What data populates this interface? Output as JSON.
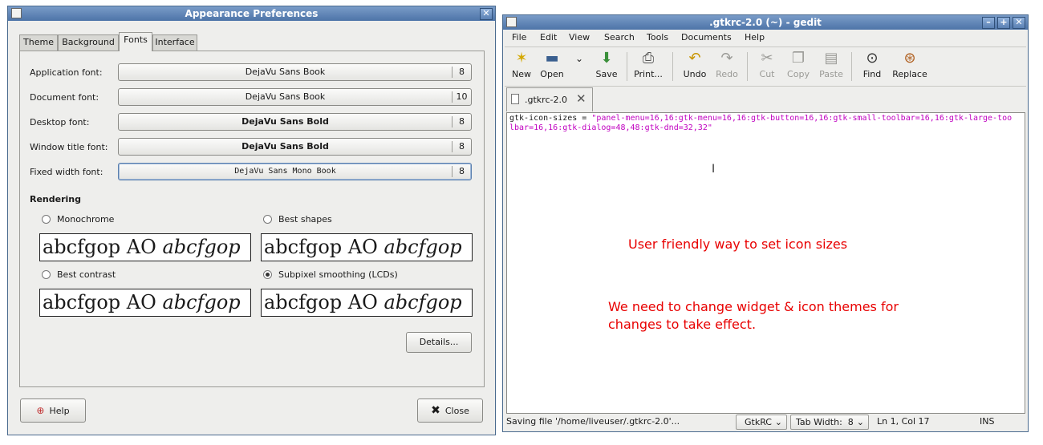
{
  "appearance": {
    "title": "Appearance Preferences",
    "tabs": [
      "Theme",
      "Background",
      "Fonts",
      "Interface"
    ],
    "active_tab": "Fonts",
    "fonts": [
      {
        "label": "Application font:",
        "font": "DejaVu Sans Book",
        "size": "8"
      },
      {
        "label": "Document font:",
        "font": "DejaVu Sans Book",
        "size": "10"
      },
      {
        "label": "Desktop font:",
        "font": "DejaVu Sans Bold",
        "size": "8"
      },
      {
        "label": "Window title font:",
        "font": "DejaVu Sans Bold",
        "size": "8"
      },
      {
        "label": "Fixed width font:",
        "font": "DejaVu Sans Mono Book",
        "size": "8"
      }
    ],
    "rendering_title": "Rendering",
    "rendering_options": [
      {
        "label": "Monochrome",
        "selected": false
      },
      {
        "label": "Best shapes",
        "selected": false
      },
      {
        "label": "Best contrast",
        "selected": false
      },
      {
        "label": "Subpixel smoothing (LCDs)",
        "selected": true
      }
    ],
    "preview_text": "abcfgop AO",
    "preview_italic": "abcfgop",
    "details_label": "Details...",
    "help_label": "Help",
    "close_label": "Close"
  },
  "gedit": {
    "title": ".gtkrc-2.0 (~) - gedit",
    "menu": [
      "File",
      "Edit",
      "View",
      "Search",
      "Tools",
      "Documents",
      "Help"
    ],
    "toolbar": [
      "New",
      "Open",
      "Save",
      "Print...",
      "Undo",
      "Redo",
      "Cut",
      "Copy",
      "Paste",
      "Find",
      "Replace"
    ],
    "tab_label": ".gtkrc-2.0",
    "code_key": "gtk-icon-sizes = ",
    "code_value": "\"panel-menu=16,16:gtk-menu=16,16:gtk-button=16,16:gtk-small-toolbar=16,16:gtk-large-toolbar=16,16:gtk-dialog=48,48:gtk-dnd=32,32\"",
    "note1": "User friendly way to set icon sizes",
    "note2_line1": "We need to change widget & icon themes for",
    "note2_line2": "changes to take effect.",
    "status_text": "Saving file '/home/liveuser/.gtkrc-2.0'...",
    "language": "GtkRC",
    "tab_width": "Tab Width:  8",
    "position": "Ln 1, Col 17",
    "mode": "INS",
    "note_color": "#e80000",
    "string_color": "#c000c0"
  }
}
